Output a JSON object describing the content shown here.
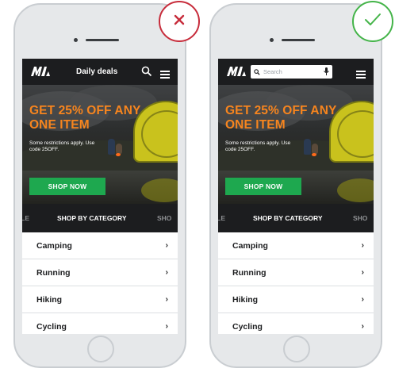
{
  "left_phone": {
    "nav": {
      "deals_label": "Daily deals"
    },
    "hero": {
      "headline_line1": "GET 25% OFF ANY",
      "headline_line2": "ONE ITEM",
      "fine_print_line1": "Some restrictions apply. Use",
      "fine_print_line2": "code 25OFF.",
      "cta_label": "SHOP NOW"
    },
    "category_bar": {
      "prev": "ALE",
      "active": "SHOP BY CATEGORY",
      "next": "SHO"
    },
    "categories": [
      "Camping",
      "Running",
      "Hiking",
      "Cycling"
    ],
    "verdict": "x"
  },
  "right_phone": {
    "nav": {
      "search_placeholder": "Search"
    },
    "hero": {
      "headline_line1": "GET 25% OFF ANY",
      "headline_line2": "ONE ITEM",
      "fine_print_line1": "Some restrictions apply. Use",
      "fine_print_line2": "code 25OFF.",
      "cta_label": "SHOP NOW"
    },
    "category_bar": {
      "prev": "ALE",
      "active": "SHOP BY CATEGORY",
      "next": "SHO"
    },
    "categories": [
      "Camping",
      "Running",
      "Hiking",
      "Cycling"
    ],
    "verdict": "check"
  },
  "chevron": "›",
  "colors": {
    "nav_bg": "#1c1d1f",
    "headline": "#f7851e",
    "cta_green": "#1ea84f",
    "bad_red": "#c72c3b",
    "good_green": "#44b449"
  },
  "icons": [
    "logo-icon",
    "search-icon",
    "menu-icon",
    "microphone-icon",
    "close-icon",
    "checkmark-icon",
    "chevron-right-icon"
  ]
}
